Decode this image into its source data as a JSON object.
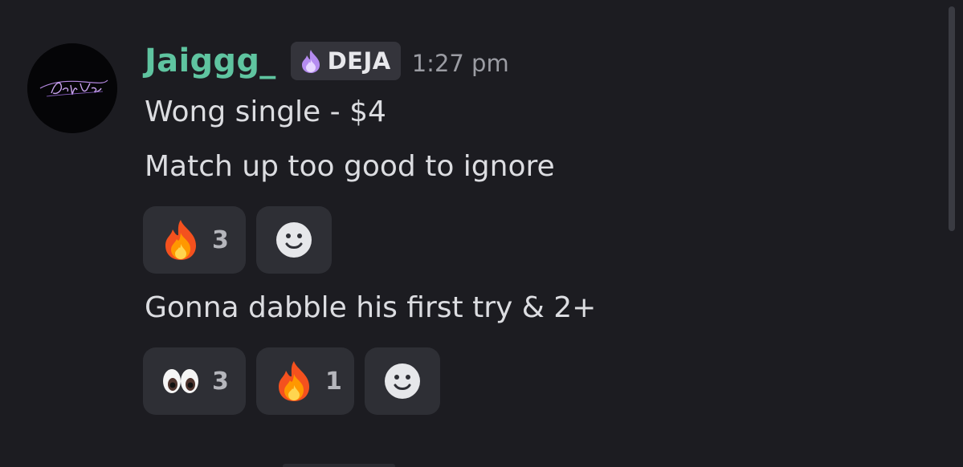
{
  "message": {
    "author": "Jaiggg_",
    "role_tag": "DEJA",
    "timestamp": "1:27 pm",
    "avatar_icon": "deja-vu-logo-avatar",
    "lines": [
      {
        "text": "Wong single - $4"
      },
      {
        "text": "Match up too good to ignore",
        "reactions": [
          {
            "emoji": "fire-emoji",
            "count": "3"
          },
          {
            "emoji": "add-reaction-icon"
          }
        ]
      },
      {
        "text": "Gonna dabble his first try & 2+",
        "reactions": [
          {
            "emoji": "eyes-emoji",
            "count": "3"
          },
          {
            "emoji": "fire-emoji",
            "count": "1"
          },
          {
            "emoji": "add-reaction-icon"
          }
        ]
      }
    ]
  },
  "colors": {
    "background": "#1c1c21",
    "username": "#5fc4a0",
    "tag_background": "#34343b",
    "reaction_background": "#2e2f35",
    "message_text": "#dcdde1",
    "timestamp_text": "#9b9ca3"
  }
}
